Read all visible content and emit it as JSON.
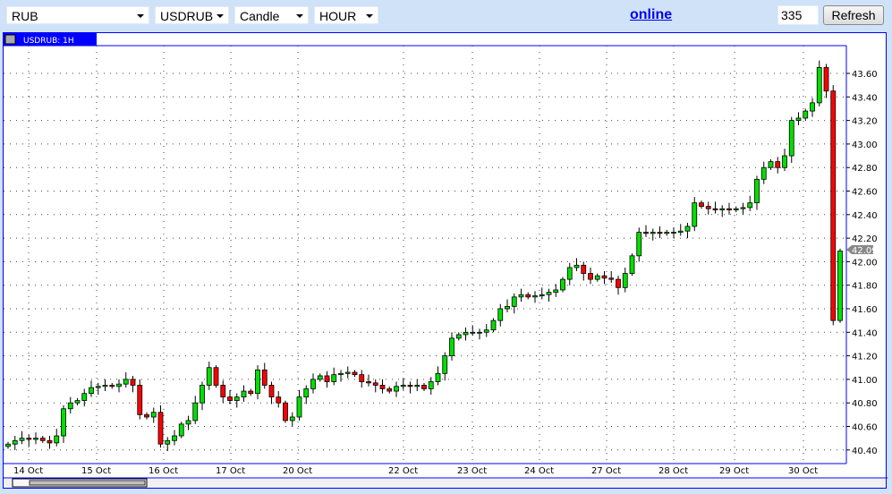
{
  "toolbar": {
    "currency": "RUB",
    "symbol": "USDRUB",
    "chart_type": "Candle",
    "timeframe": "HOUR",
    "status_link": "online",
    "bars_count": "335",
    "refresh_label": "Refresh"
  },
  "chart": {
    "tab_label": "USDRUB: 1H",
    "tab_icon": "window-icon",
    "last_price": "42.09",
    "colors": {
      "up": "#00e000",
      "down": "#ff0000",
      "frame": "#0000ff",
      "last_tag": "#888888"
    }
  },
  "chart_data": {
    "type": "candlestick",
    "title": "USDRUB: 1H",
    "y_ticks": [
      "40.40",
      "40.60",
      "40.80",
      "41.00",
      "41.20",
      "41.40",
      "41.60",
      "41.80",
      "42.00",
      "42.20",
      "42.40",
      "42.60",
      "42.80",
      "43.00",
      "43.20",
      "43.40",
      "43.60"
    ],
    "ylim": [
      40.4,
      43.6
    ],
    "x_ticks": [
      "14 Oct",
      "15 Oct",
      "16 Oct",
      "17 Oct",
      "20 Oct",
      "22 Oct",
      "23 Oct",
      "24 Oct",
      "27 Oct",
      "28 Oct",
      "29 Oct",
      "30 Oct"
    ],
    "approx_closes": [
      40.45,
      40.48,
      40.5,
      40.49,
      40.5,
      40.48,
      40.46,
      40.52,
      40.75,
      40.8,
      40.82,
      40.88,
      40.93,
      40.94,
      40.95,
      40.94,
      40.96,
      41.0,
      40.95,
      40.7,
      40.68,
      40.72,
      40.45,
      40.48,
      40.52,
      40.62,
      40.65,
      40.8,
      40.95,
      41.1,
      40.95,
      40.85,
      40.82,
      40.85,
      40.9,
      40.88,
      41.08,
      40.95,
      40.85,
      40.8,
      40.65,
      40.68,
      40.85,
      40.92,
      41.0,
      41.03,
      40.98,
      41.04,
      41.05,
      41.06,
      41.04,
      40.98,
      40.97,
      40.95,
      40.92,
      40.9,
      40.94,
      40.95,
      40.94,
      40.95,
      40.92,
      40.98,
      41.05,
      41.2,
      41.35,
      41.38,
      41.4,
      41.4,
      41.4,
      41.42,
      41.5,
      41.6,
      41.62,
      41.7,
      41.72,
      41.7,
      41.71,
      41.72,
      41.74,
      41.76,
      41.85,
      41.95,
      41.97,
      41.9,
      41.85,
      41.88,
      41.86,
      41.85,
      41.78,
      41.9,
      42.05,
      42.25,
      42.24,
      42.25,
      42.24,
      42.25,
      42.25,
      42.26,
      42.3,
      42.5,
      42.47,
      42.45,
      42.44,
      42.45,
      42.44,
      42.45,
      42.46,
      42.5,
      42.7,
      42.8,
      42.85,
      42.8,
      42.9,
      43.2,
      43.22,
      43.28,
      43.35,
      43.65,
      43.45,
      41.5,
      42.09
    ]
  }
}
